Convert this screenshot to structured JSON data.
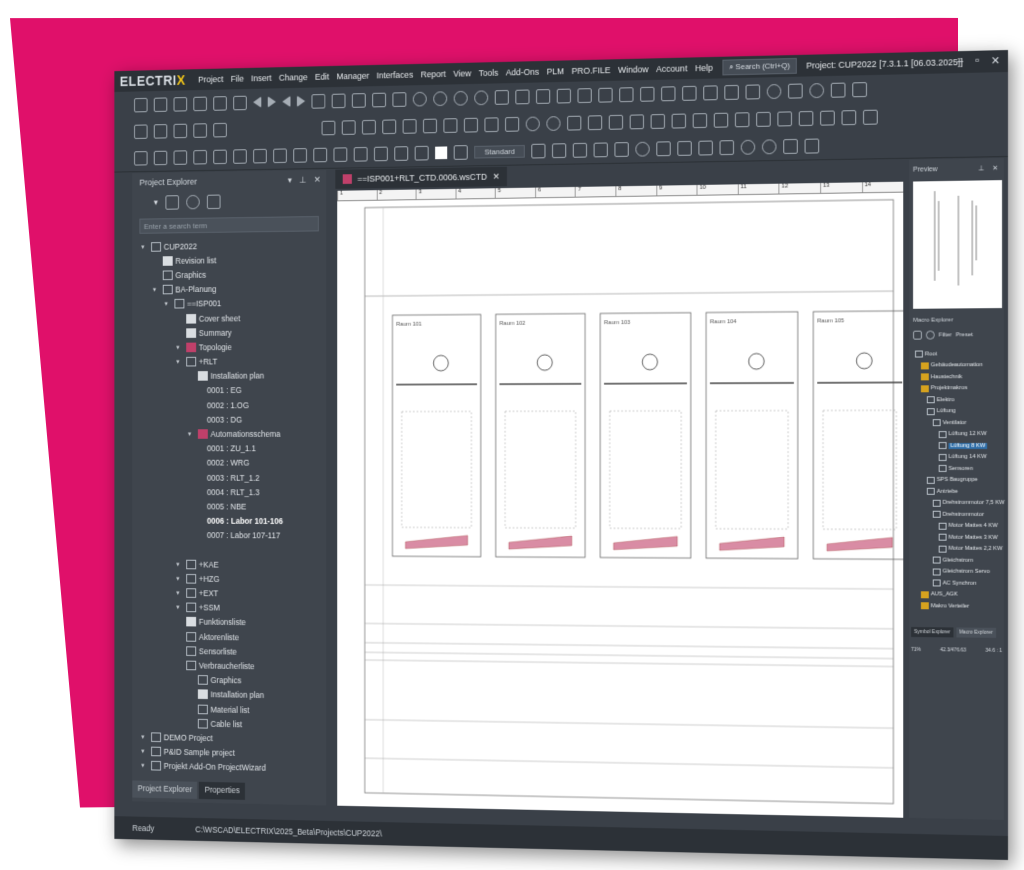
{
  "colors": {
    "accent": "#e0106a",
    "window_bg": "#3a4048",
    "logo_x": "#f0c419"
  },
  "app": {
    "logo_main": "ELECTRI",
    "logo_x": "X"
  },
  "menu": [
    "Project",
    "File",
    "Insert",
    "Change",
    "Edit",
    "Manager",
    "Interfaces",
    "Report",
    "View",
    "Tools",
    "Add-Ons",
    "PLM",
    "PRO.FILE",
    "Window",
    "Account",
    "Help"
  ],
  "search": {
    "label": "Search (Ctrl+Q)"
  },
  "window_title": "Project: CUP2022 [7.3.1.1 [06.03.2025]]",
  "window_controls": {
    "min": "–",
    "max": "▫",
    "close": "✕"
  },
  "toolbar": {
    "style_value": "Standard"
  },
  "explorer": {
    "title": "Project Explorer",
    "search_placeholder": "Enter a search term",
    "tree": [
      {
        "label": "CUP2022",
        "level": 0,
        "icon": "folder"
      },
      {
        "label": "Revision list",
        "level": 1,
        "icon": "page"
      },
      {
        "label": "Graphics",
        "level": 1,
        "icon": "graphic"
      },
      {
        "label": "BA-Planung",
        "level": 1,
        "icon": "folder"
      },
      {
        "label": "==ISP001",
        "level": 2,
        "icon": "folder"
      },
      {
        "label": "Cover sheet",
        "level": 3,
        "icon": "page"
      },
      {
        "label": "Summary",
        "level": 3,
        "icon": "page"
      },
      {
        "label": "Topologie",
        "level": 3,
        "icon": "red"
      },
      {
        "label": "+RLT",
        "level": 3,
        "icon": "folder"
      },
      {
        "label": "Installation plan",
        "level": 4,
        "icon": "page"
      },
      {
        "label": "0001 : EG",
        "level": 5,
        "icon": "none"
      },
      {
        "label": "0002 : 1.OG",
        "level": 5,
        "icon": "none"
      },
      {
        "label": "0003 : DG",
        "level": 5,
        "icon": "none"
      },
      {
        "label": "Automationsschema",
        "level": 4,
        "icon": "red"
      },
      {
        "label": "0001 : ZU_1.1",
        "level": 5,
        "icon": "none"
      },
      {
        "label": "0002 : WRG",
        "level": 5,
        "icon": "none"
      },
      {
        "label": "0003 : RLT_1.2",
        "level": 5,
        "icon": "none"
      },
      {
        "label": "0004 : RLT_1.3",
        "level": 5,
        "icon": "none"
      },
      {
        "label": "0005 : NBE",
        "level": 5,
        "icon": "none"
      },
      {
        "label": "0006 : Labor 101-106",
        "level": 5,
        "icon": "none",
        "selected": true
      },
      {
        "label": "0007 : Labor 107-117",
        "level": 5,
        "icon": "none"
      },
      {
        "label": "",
        "level": 5,
        "icon": "none"
      },
      {
        "label": "+KAE",
        "level": 3,
        "icon": "folder"
      },
      {
        "label": "+HZG",
        "level": 3,
        "icon": "folder"
      },
      {
        "label": "+EXT",
        "level": 3,
        "icon": "folder"
      },
      {
        "label": "+SSM",
        "level": 3,
        "icon": "folder"
      },
      {
        "label": "Funktionsliste",
        "level": 3,
        "icon": "page"
      },
      {
        "label": "Aktorenliste",
        "level": 3,
        "icon": "list"
      },
      {
        "label": "Sensorliste",
        "level": 3,
        "icon": "list"
      },
      {
        "label": "Verbraucherliste",
        "level": 3,
        "icon": "list"
      },
      {
        "label": "Graphics",
        "level": 4,
        "icon": "graphic"
      },
      {
        "label": "Installation plan",
        "level": 4,
        "icon": "page"
      },
      {
        "label": "Material list",
        "level": 4,
        "icon": "list"
      },
      {
        "label": "Cable list",
        "level": 4,
        "icon": "list"
      },
      {
        "label": "DEMO Project",
        "level": 0,
        "icon": "folder"
      },
      {
        "label": "P&ID Sample project",
        "level": 0,
        "icon": "folder"
      },
      {
        "label": "Projekt Add-On ProjectWizard",
        "level": 0,
        "icon": "folder"
      }
    ],
    "tabs": [
      "Project Explorer",
      "Properties"
    ]
  },
  "status": {
    "text": "Ready",
    "path": "C:\\WSCAD\\ELECTRIX\\2025_Beta\\Projects\\CUP2022\\",
    "zoom": "71%",
    "coords": "42.3/476.63",
    "value": "34.6 : 1"
  },
  "document": {
    "tab_label": "==ISP001+RLT_CTD.0006.wsCTD",
    "ruler": [
      "1",
      "2",
      "3",
      "4",
      "5",
      "6",
      "7",
      "8",
      "9",
      "10",
      "11",
      "12",
      "13",
      "14"
    ],
    "rooms": [
      "Raum 101",
      "Raum 102",
      "Raum 103",
      "Raum 104",
      "Raum 105"
    ]
  },
  "preview": {
    "title": "Preview"
  },
  "macro": {
    "title": "Macro Explorer",
    "filter_label": "Filter",
    "preset_label": "Preset",
    "tree": [
      {
        "label": "Root",
        "level": 0,
        "icon": "folder"
      },
      {
        "label": "Gebäudeautomation",
        "level": 1,
        "icon": "yfolder"
      },
      {
        "label": "Haustechnik",
        "level": 1,
        "icon": "yfolder"
      },
      {
        "label": "Projektmakros",
        "level": 1,
        "icon": "yfolder"
      },
      {
        "label": "Elektro",
        "level": 2,
        "icon": "folder"
      },
      {
        "label": "Lüftung",
        "level": 2,
        "icon": "folder"
      },
      {
        "label": "Ventilator",
        "level": 3,
        "icon": "folder"
      },
      {
        "label": "Lüftung 12 KW",
        "level": 4,
        "icon": "page"
      },
      {
        "label": "Lüftung 8 KW",
        "level": 4,
        "icon": "page",
        "selected": true
      },
      {
        "label": "Lüftung 14 KW",
        "level": 4,
        "icon": "page"
      },
      {
        "label": "Sensoren",
        "level": 4,
        "icon": "page"
      },
      {
        "label": "SPS Baugruppe",
        "level": 2,
        "icon": "folder"
      },
      {
        "label": "Antriebe",
        "level": 2,
        "icon": "folder"
      },
      {
        "label": "Drehstrommotor 7,5 KW",
        "level": 3,
        "icon": "page"
      },
      {
        "label": "Drehstrommotor",
        "level": 3,
        "icon": "folder"
      },
      {
        "label": "Motor Mattes 4 KW",
        "level": 4,
        "icon": "page"
      },
      {
        "label": "Motor Mattes 3 KW",
        "level": 4,
        "icon": "page"
      },
      {
        "label": "Motor Mattes 2,2 KW",
        "level": 4,
        "icon": "page"
      },
      {
        "label": "Gleichstrom",
        "level": 3,
        "icon": "page"
      },
      {
        "label": "Gleichstrom Servo",
        "level": 3,
        "icon": "page"
      },
      {
        "label": "AC Synchron",
        "level": 3,
        "icon": "page"
      },
      {
        "label": "AUS_AGK",
        "level": 1,
        "icon": "yfolder"
      },
      {
        "label": "Makro Verteiler",
        "level": 1,
        "icon": "yfolder"
      }
    ],
    "tabs": [
      "Symbol Explorer",
      "Macro Explorer"
    ]
  }
}
